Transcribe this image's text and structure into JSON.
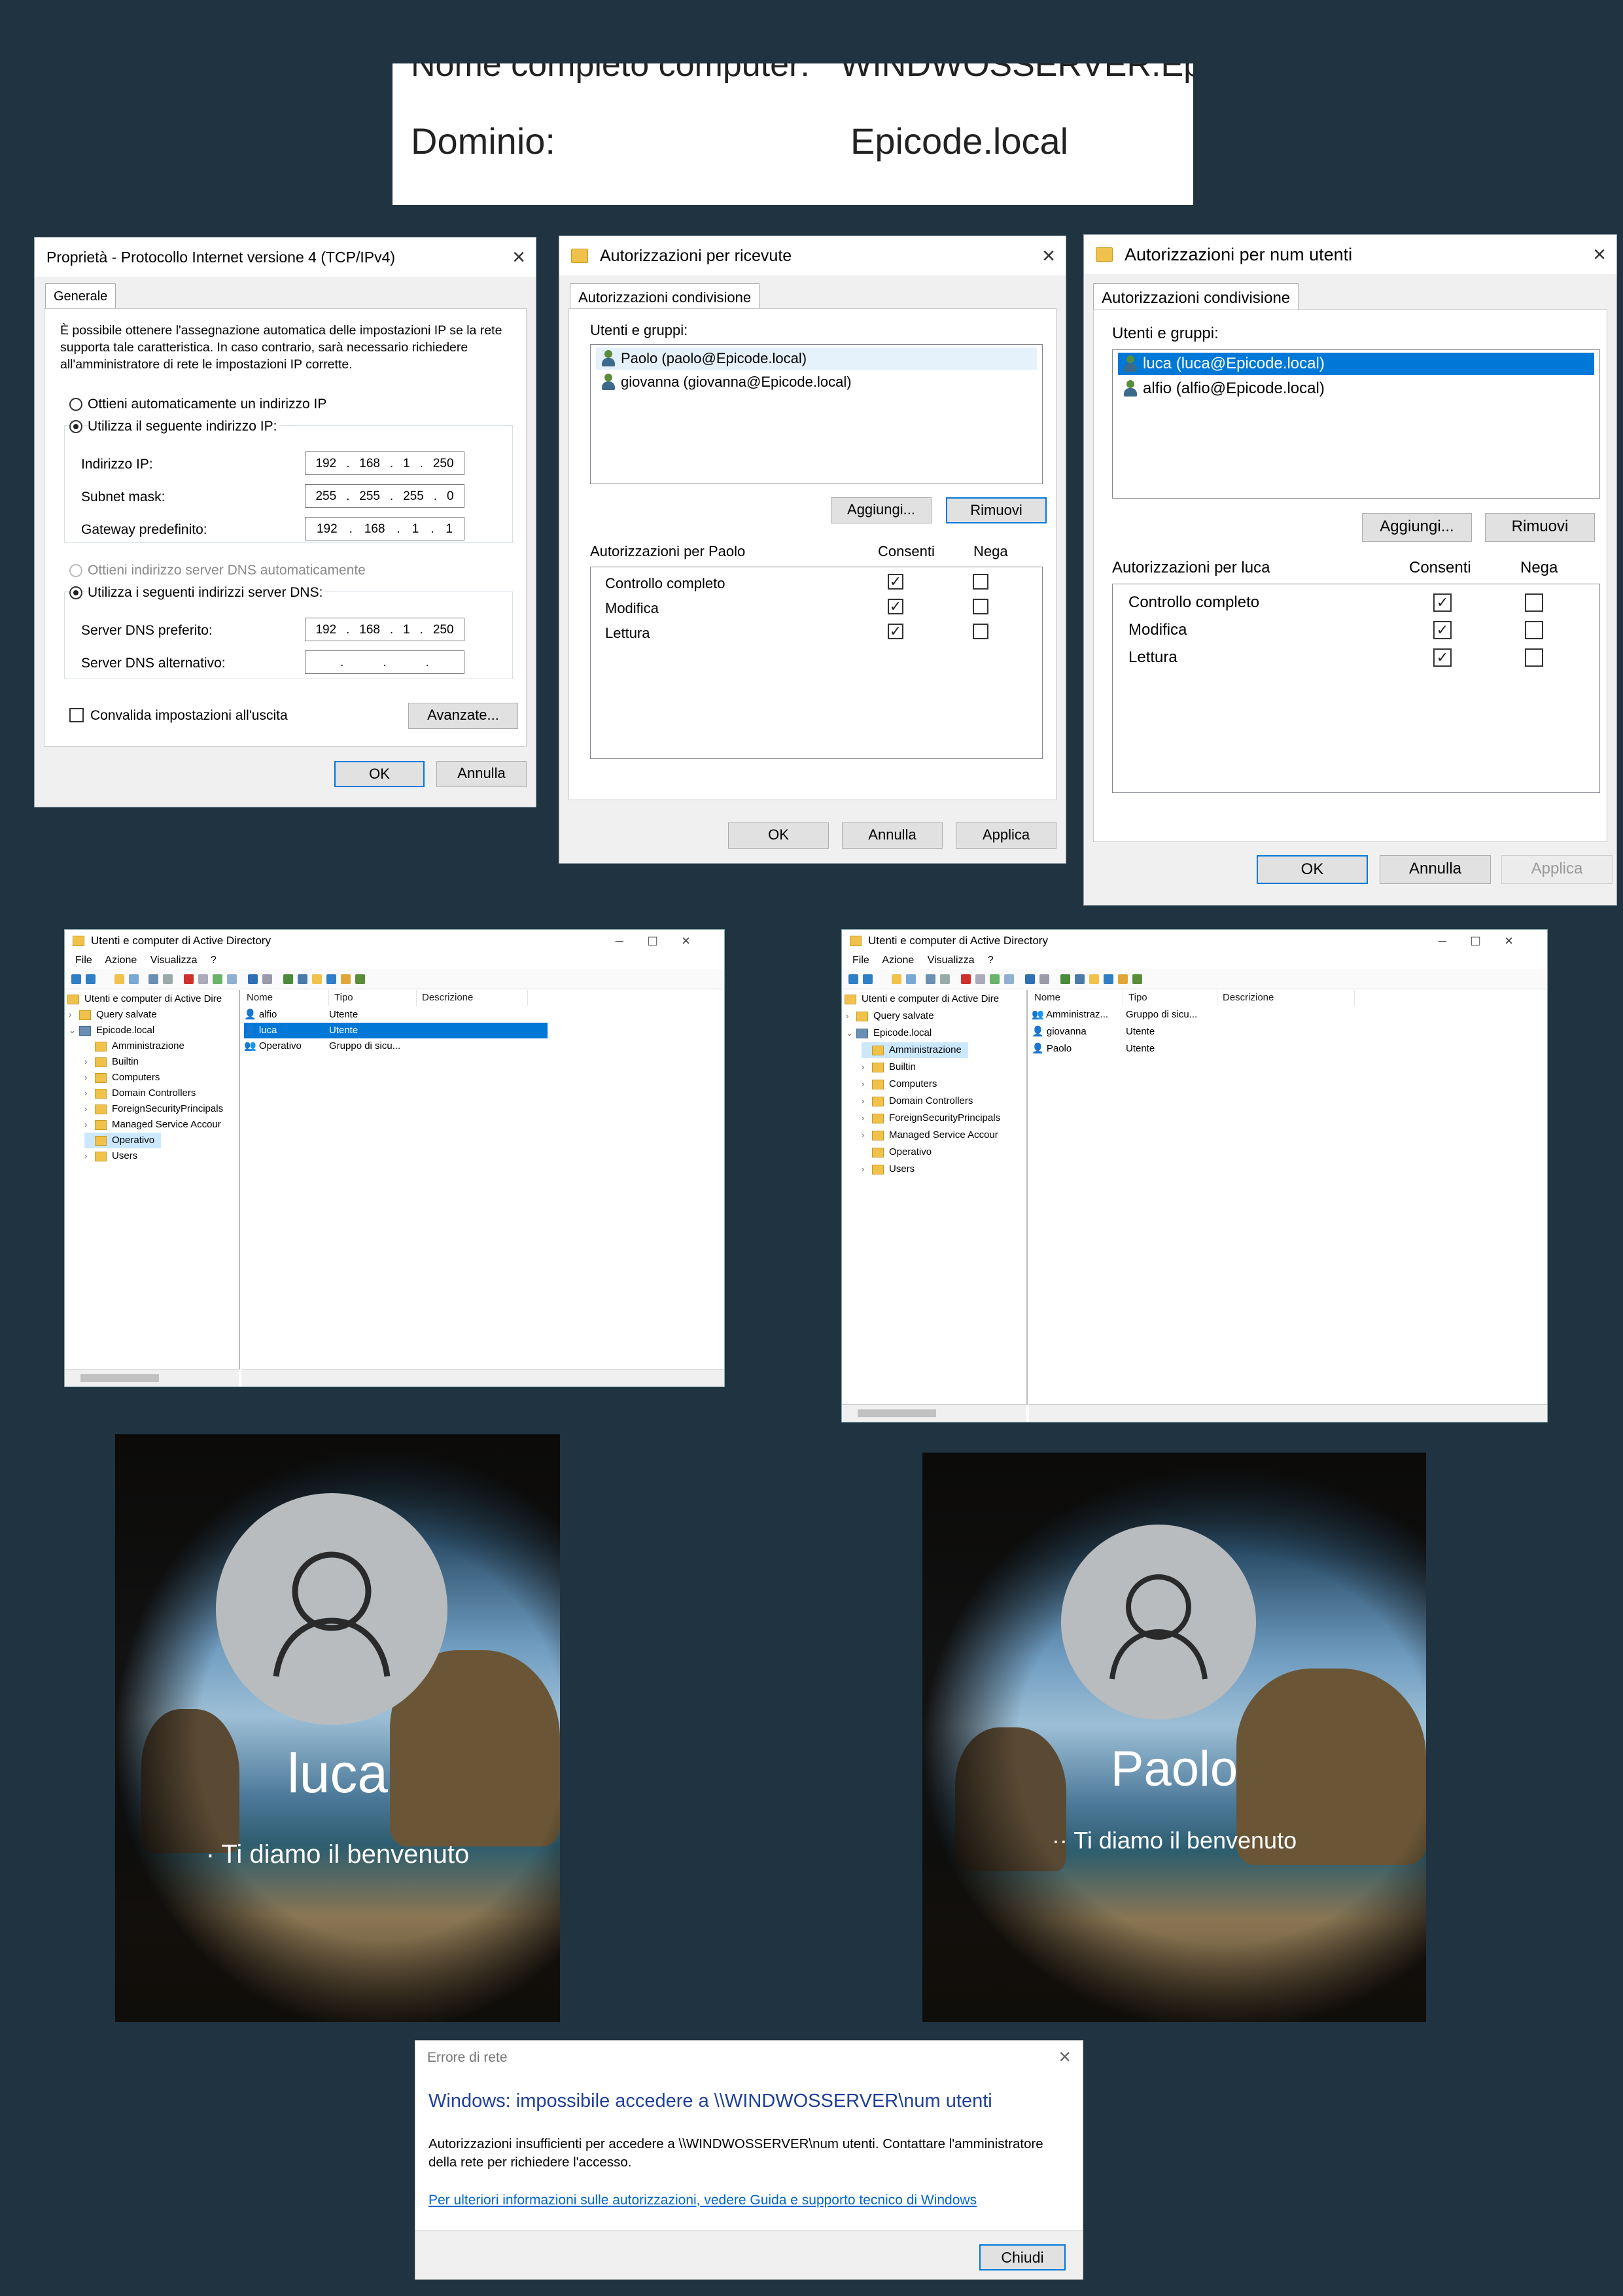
{
  "domain_panel": {
    "fullname_label": "Nome completo computer:",
    "fullname_value": "WINDWOSSERVER.Epicod",
    "domain_label": "Dominio:",
    "domain_value": "Epicode.local"
  },
  "ipv4": {
    "title": "Proprietà - Protocollo Internet versione 4 (TCP/IPv4)",
    "tab": "Generale",
    "description": "È possibile ottenere l'assegnazione automatica delle impostazioni IP se la rete supporta tale caratteristica. In caso contrario, sarà necessario richiedere all'amministratore di rete le impostazioni IP corrette.",
    "auto_ip": "Ottieni automaticamente un indirizzo IP",
    "manual_ip": "Utilizza il seguente indirizzo IP:",
    "ip_label": "Indirizzo IP:",
    "ip": [
      "192",
      "168",
      "1",
      "250"
    ],
    "mask_label": "Subnet mask:",
    "mask": [
      "255",
      "255",
      "255",
      "0"
    ],
    "gw_label": "Gateway predefinito:",
    "gw": [
      "192",
      "168",
      "1",
      "1"
    ],
    "auto_dns": "Ottieni indirizzo server DNS automaticamente",
    "manual_dns": "Utilizza i seguenti indirizzi server DNS:",
    "dns1_label": "Server DNS preferito:",
    "dns1": [
      "192",
      "168",
      "1",
      "250"
    ],
    "dns2_label": "Server DNS alternativo:",
    "validate": "Convalida impostazioni all'uscita",
    "advanced": "Avanzate...",
    "ok": "OK",
    "cancel": "Annulla"
  },
  "perm_ricevute": {
    "title": "Autorizzazioni per ricevute",
    "tab": "Autorizzazioni condivisione",
    "users_label": "Utenti e gruppi:",
    "users": [
      "Paolo (paolo@Epicode.local)",
      "giovanna (giovanna@Epicode.local)"
    ],
    "add": "Aggiungi...",
    "remove": "Rimuovi",
    "perm_header": "Autorizzazioni per Paolo",
    "allow": "Consenti",
    "deny": "Nega",
    "perms": [
      "Controllo completo",
      "Modifica",
      "Lettura"
    ],
    "ok": "OK",
    "cancel": "Annulla",
    "apply": "Applica"
  },
  "perm_num_utenti": {
    "title": "Autorizzazioni per num utenti",
    "tab": "Autorizzazioni condivisione",
    "users_label": "Utenti e gruppi:",
    "users": [
      "luca (luca@Epicode.local)",
      "alfio (alfio@Epicode.local)"
    ],
    "add": "Aggiungi...",
    "remove": "Rimuovi",
    "perm_header": "Autorizzazioni per luca",
    "allow": "Consenti",
    "deny": "Nega",
    "perms": [
      "Controllo completo",
      "Modifica",
      "Lettura"
    ],
    "ok": "OK",
    "cancel": "Annulla",
    "apply": "Applica"
  },
  "ad_common": {
    "title": "Utenti e computer di Active Directory",
    "menu": [
      "File",
      "Azione",
      "Visualizza",
      "?"
    ],
    "col_name": "Nome",
    "col_type": "Tipo",
    "col_desc": "Descrizione",
    "tree": {
      "root": "Utenti e computer di Active Dire",
      "saved": "Query salvate",
      "domain": "Epicode.local",
      "ous": [
        "Amministrazione",
        "Builtin",
        "Computers",
        "Domain Controllers",
        "ForeignSecurityPrincipals",
        "Managed Service Accour",
        "Operativo",
        "Users"
      ]
    }
  },
  "ad_left": {
    "rows": [
      {
        "name": "alfio",
        "type": "Utente"
      },
      {
        "name": "luca",
        "type": "Utente"
      },
      {
        "name": "Operativo",
        "type": "Gruppo di sicu..."
      }
    ]
  },
  "ad_right": {
    "rows": [
      {
        "name": "Amministraz...",
        "type": "Gruppo di sicu..."
      },
      {
        "name": "giovanna",
        "type": "Utente"
      },
      {
        "name": "Paolo",
        "type": "Utente"
      }
    ]
  },
  "lock_left": {
    "name": "luca",
    "welcome": "Ti diamo il benvenuto"
  },
  "lock_right": {
    "name": "Paolo",
    "welcome": "Ti diamo il benvenuto"
  },
  "error": {
    "title": "Errore di rete",
    "heading": "Windows: impossibile accedere a \\\\WINDWOSSERVER\\num utenti",
    "message": "Autorizzazioni insufficienti per accedere a \\\\WINDWOSSERVER\\num utenti. Contattare l'amministratore della rete per richiedere l'accesso.",
    "link": "Per ulteriori informazioni sulle autorizzazioni, vedere Guida e supporto tecnico di Windows",
    "close": "Chiudi"
  }
}
